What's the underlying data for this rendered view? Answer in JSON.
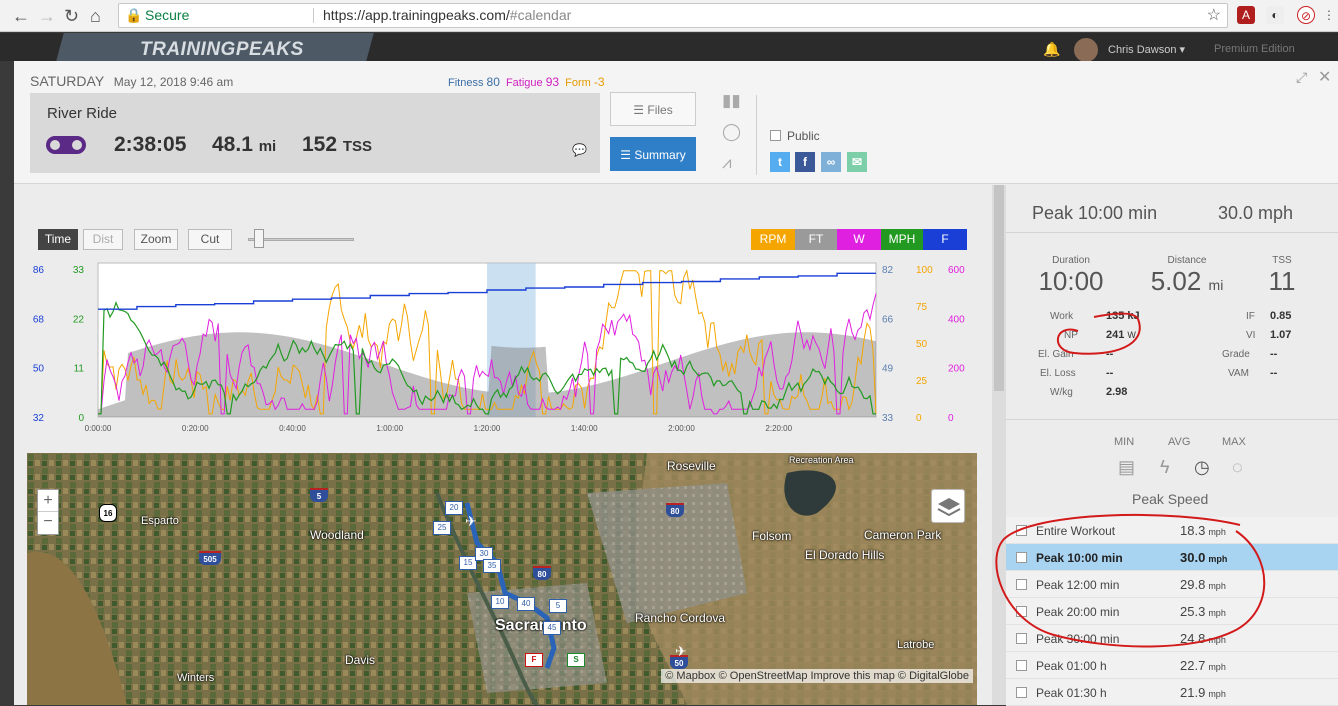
{
  "browser": {
    "secure_label": "Secure",
    "url_host": "https://app.trainingpeaks.com/",
    "url_path": "#calendar"
  },
  "appbar": {
    "logo": "TRAININGPEAKS",
    "user": "Chris Dawson ▾",
    "edition": "Premium Edition"
  },
  "workout": {
    "day": "SATURDAY",
    "date": "May 12, 2018   9:46 am",
    "fitness_label": "Fitness",
    "fitness": "80",
    "fatigue_label": "Fatigue",
    "fatigue": "93",
    "form_label": "Form",
    "form": "-3",
    "title": "River Ride",
    "duration": "2:38:05",
    "distance": "48.1",
    "distance_unit": "mi",
    "tss": "152",
    "tss_unit": "TSS",
    "files_btn": "Files",
    "summary_btn": "Summary",
    "public_label": "Public"
  },
  "toolbar": {
    "time": "Time",
    "dist": "Dist",
    "zoom": "Zoom",
    "cut": "Cut",
    "legend": [
      "RPM",
      "FT",
      "W",
      "MPH",
      "F"
    ]
  },
  "colors": {
    "rpm": "#f5a500",
    "ft": "#8c8c8c",
    "w": "#e020e0",
    "mph": "#229a22",
    "f": "#1a3fd6",
    "accent": "#2f7fc8"
  },
  "chart_data": {
    "type": "line",
    "x_ticks": [
      "0:00:00",
      "0:20:00",
      "0:40:00",
      "1:00:00",
      "1:20:00",
      "1:40:00",
      "2:00:00",
      "2:20:00"
    ],
    "left_axis_outer": [
      "86",
      "68",
      "50",
      "32"
    ],
    "left_axis_inner": [
      "33",
      "22",
      "11",
      "0"
    ],
    "right_axis_1": [
      "82",
      "66",
      "49",
      "33"
    ],
    "right_axis_2": [
      "100",
      "75",
      "50",
      "25",
      "0"
    ],
    "right_axis_3": [
      "600",
      "400",
      "200",
      "0"
    ],
    "series": [
      {
        "name": "RPM",
        "unit": "rpm"
      },
      {
        "name": "FT",
        "unit": "ft"
      },
      {
        "name": "W",
        "unit": "W"
      },
      {
        "name": "MPH",
        "unit": "mph"
      },
      {
        "name": "F",
        "unit": "F"
      }
    ],
    "highlight_range": [
      "1:20:00",
      "1:30:00"
    ]
  },
  "map": {
    "labels": [
      "Roseville",
      "Esparto",
      "Woodland",
      "Folsom",
      "El Dorado Hills",
      "Cameron Park",
      "Rancho Cordova",
      "Sacramento",
      "Davis",
      "Winters",
      "Latrobe",
      "Recreation Area"
    ],
    "highways": [
      "16",
      "5",
      "505",
      "80",
      "80",
      "50",
      "5",
      "20",
      "25",
      "15",
      "30",
      "35",
      "10",
      "40",
      "5",
      "45"
    ],
    "start": "S",
    "finish": "F",
    "attribution": "© Mapbox © OpenStreetMap Improve this map © DigitalGlobe"
  },
  "peak": {
    "title": "Peak 10:00 min",
    "value": "30.0 mph",
    "duration_label": "Duration",
    "duration": "10:00",
    "distance_label": "Distance",
    "distance": "5.02",
    "distance_unit": "mi",
    "tss_label": "TSS",
    "tss": "11",
    "work_label": "Work",
    "work": "135 kJ",
    "np_label": "NP",
    "np": "241",
    "np_unit": "W",
    "elgain_label": "El. Gain",
    "elgain": "--",
    "elloss_label": "El. Loss",
    "elloss": "--",
    "wkg_label": "W/kg",
    "wkg": "2.98",
    "if_label": "IF",
    "if": "0.85",
    "vi_label": "VI",
    "vi": "1.07",
    "grade_label": "Grade",
    "grade": "--",
    "vam_label": "VAM",
    "vam": "--",
    "min_label": "MIN",
    "avg_label": "AVG",
    "max_label": "MAX",
    "peak_speed_label": "Peak Speed",
    "rows": [
      {
        "name": "Entire Workout",
        "value": "18.3",
        "unit": "mph"
      },
      {
        "name": "Peak 10:00 min",
        "value": "30.0",
        "unit": "mph"
      },
      {
        "name": "Peak 12:00 min",
        "value": "29.8",
        "unit": "mph"
      },
      {
        "name": "Peak 20:00 min",
        "value": "25.3",
        "unit": "mph"
      },
      {
        "name": "Peak 30:00 min",
        "value": "24.8",
        "unit": "mph"
      },
      {
        "name": "Peak 01:00 h",
        "value": "22.7",
        "unit": "mph"
      },
      {
        "name": "Peak 01:30 h",
        "value": "21.9",
        "unit": "mph"
      }
    ]
  }
}
